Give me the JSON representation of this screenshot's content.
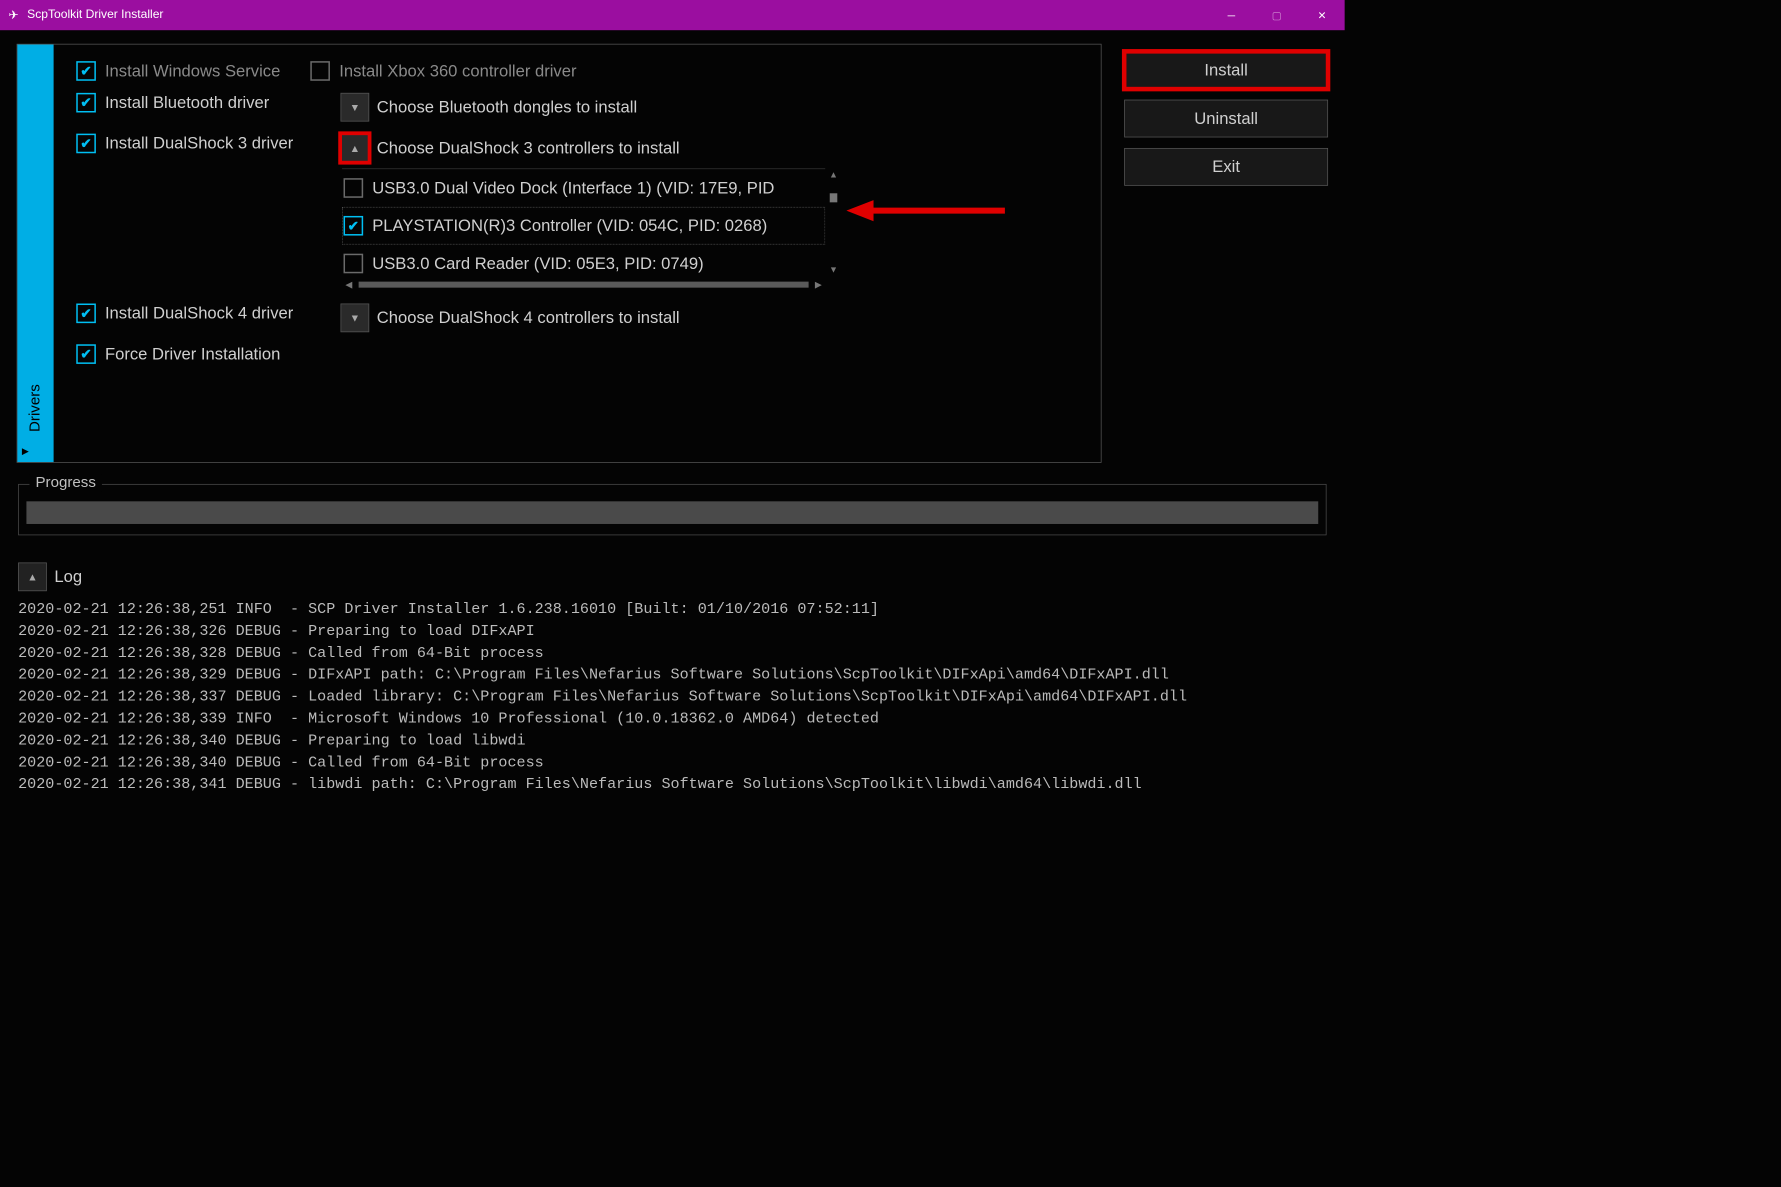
{
  "window": {
    "title": "ScpToolkit Driver Installer"
  },
  "sideTab": {
    "label": "Drivers"
  },
  "options": {
    "winService": {
      "label": "Install Windows Service",
      "checked": true
    },
    "xbox": {
      "label": "Install Xbox 360 controller driver",
      "checked": false
    },
    "bluetooth": {
      "label": "Install Bluetooth driver",
      "checked": true
    },
    "btChooser": {
      "label": "Choose Bluetooth dongles to install"
    },
    "ds3": {
      "label": "Install DualShock 3 driver",
      "checked": true
    },
    "ds3Chooser": {
      "label": "Choose DualShock 3 controllers to install"
    },
    "ds4": {
      "label": "Install DualShock 4 driver",
      "checked": true
    },
    "ds4Chooser": {
      "label": "Choose DualShock 4 controllers to install"
    },
    "force": {
      "label": "Force Driver Installation",
      "checked": true
    }
  },
  "ds3Devices": [
    {
      "label": "USB3.0 Dual Video Dock (Interface 1) (VID: 17E9, PID",
      "checked": false
    },
    {
      "label": "PLAYSTATION(R)3 Controller (VID: 054C, PID: 0268)",
      "checked": true
    },
    {
      "label": "USB3.0 Card Reader (VID: 05E3, PID: 0749)",
      "checked": false
    }
  ],
  "actions": {
    "install": "Install",
    "uninstall": "Uninstall",
    "exit": "Exit"
  },
  "progress": {
    "legend": "Progress"
  },
  "log": {
    "label": "Log",
    "lines": [
      "2020-02-21 12:26:38,251 INFO  - SCP Driver Installer 1.6.238.16010 [Built: 01/10/2016 07:52:11]",
      "2020-02-21 12:26:38,326 DEBUG - Preparing to load DIFxAPI",
      "2020-02-21 12:26:38,328 DEBUG - Called from 64-Bit process",
      "2020-02-21 12:26:38,329 DEBUG - DIFxAPI path: C:\\Program Files\\Nefarius Software Solutions\\ScpToolkit\\DIFxApi\\amd64\\DIFxAPI.dll",
      "2020-02-21 12:26:38,337 DEBUG - Loaded library: C:\\Program Files\\Nefarius Software Solutions\\ScpToolkit\\DIFxApi\\amd64\\DIFxAPI.dll",
      "2020-02-21 12:26:38,339 INFO  - Microsoft Windows 10 Professional (10.0.18362.0 AMD64) detected",
      "2020-02-21 12:26:38,340 DEBUG - Preparing to load libwdi",
      "2020-02-21 12:26:38,340 DEBUG - Called from 64-Bit process",
      "2020-02-21 12:26:38,341 DEBUG - libwdi path: C:\\Program Files\\Nefarius Software Solutions\\ScpToolkit\\libwdi\\amd64\\libwdi.dll"
    ]
  }
}
